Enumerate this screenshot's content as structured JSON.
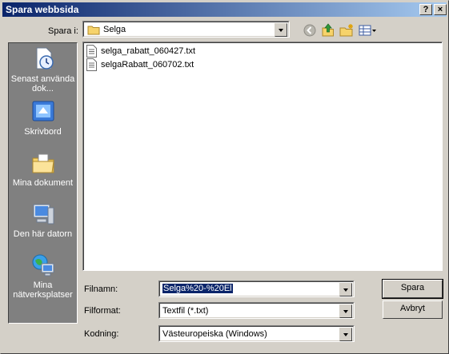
{
  "window": {
    "title": "Spara webbsida",
    "help_button": "?",
    "close_button": "×"
  },
  "location": {
    "label": "Spara i:",
    "value": "Selga"
  },
  "toolbar": {
    "icons": [
      "back-icon",
      "up-folder-icon",
      "new-folder-icon",
      "view-menu-icon"
    ]
  },
  "places": [
    {
      "label": "Senast använda dok...",
      "icon": "recent-documents-icon"
    },
    {
      "label": "Skrivbord",
      "icon": "desktop-icon"
    },
    {
      "label": "Mina dokument",
      "icon": "my-documents-icon"
    },
    {
      "label": "Den här datorn",
      "icon": "my-computer-icon"
    },
    {
      "label": "Mina nätverksplatser",
      "icon": "network-places-icon"
    }
  ],
  "files": [
    {
      "name": "selga_rabatt_060427.txt",
      "icon": "text-file-icon"
    },
    {
      "name": "selgaRabatt_060702.txt",
      "icon": "text-file-icon"
    }
  ],
  "form": {
    "filename_label": "Filnamn:",
    "filename_value": "Selga%20-%20El",
    "format_label": "Filformat:",
    "format_value": "Textfil (*.txt)",
    "encoding_label": "Kodning:",
    "encoding_value": "Västeuropeiska (Windows)"
  },
  "buttons": {
    "save": "Spara",
    "cancel": "Avbryt"
  },
  "colors": {
    "titlebar_start": "#0a246a",
    "titlebar_end": "#a6caf0",
    "dialog_bg": "#d4d0c8",
    "places_bg": "#808080",
    "selection": "#0a246a"
  }
}
